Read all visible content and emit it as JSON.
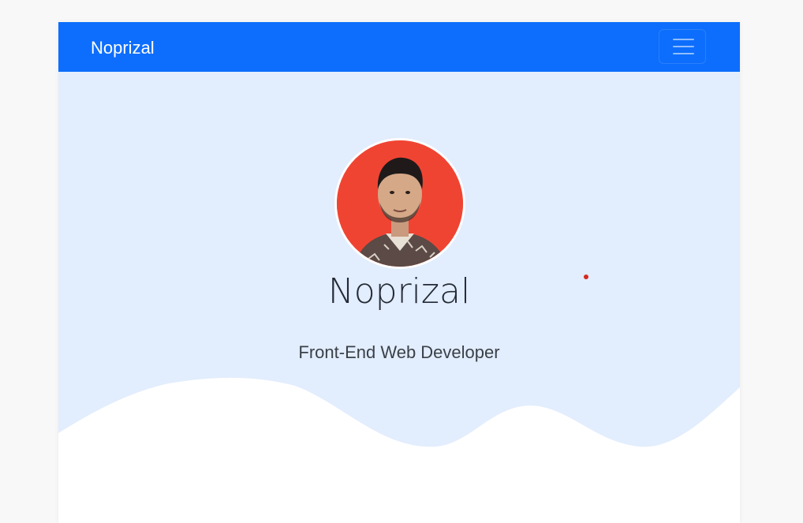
{
  "navbar": {
    "brand": "Noprizal",
    "toggler_icon": "hamburger-menu-icon",
    "color": "#0d6efd"
  },
  "hero": {
    "background_color": "#e2edfd",
    "name": "Noprizal",
    "role": "Front-End Web Developer",
    "avatar_alt": "Noprizal",
    "avatar_background": "#f04433"
  }
}
